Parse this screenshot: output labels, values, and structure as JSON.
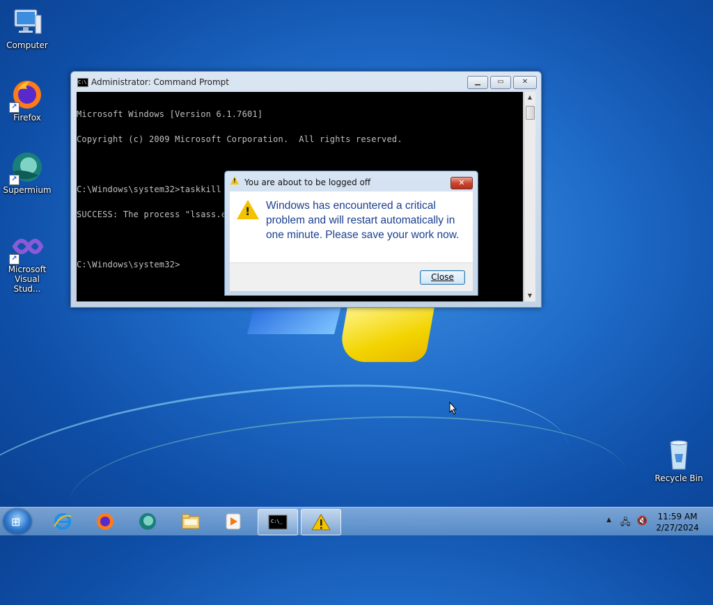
{
  "desktop": {
    "icons": [
      {
        "label": "Computer"
      },
      {
        "label": "Firefox"
      },
      {
        "label": "Supermium"
      },
      {
        "label": "Microsoft Visual Stud..."
      },
      {
        "label": "Recycle Bin"
      }
    ]
  },
  "cmd": {
    "title": "Administrator: Command Prompt",
    "lines": [
      "Microsoft Windows [Version 6.1.7601]",
      "Copyright (c) 2009 Microsoft Corporation.  All rights reserved.",
      "",
      "C:\\Windows\\system32>taskkill /IM lsass.exe /f",
      "SUCCESS: The process \"lsass.exe\" with PID 480 has been terminated.",
      "",
      "C:\\Windows\\system32>"
    ]
  },
  "dialog": {
    "title": "You are about to be logged off",
    "message": "Windows has encountered a critical problem and will restart automatically in one minute. Please save your work now.",
    "close_button": "Close"
  },
  "taskbar": {
    "pinned": [
      "start-orb",
      "internet-explorer",
      "firefox",
      "supermium",
      "file-explorer",
      "media-player",
      "command-prompt",
      "warning-dialog"
    ],
    "clock": {
      "time": "11:59 AM",
      "date": "2/27/2024"
    }
  },
  "colors": {
    "dialog_text": "#1b3f8f",
    "cmd_background": "#000000",
    "cmd_text": "#c0c0c0"
  }
}
